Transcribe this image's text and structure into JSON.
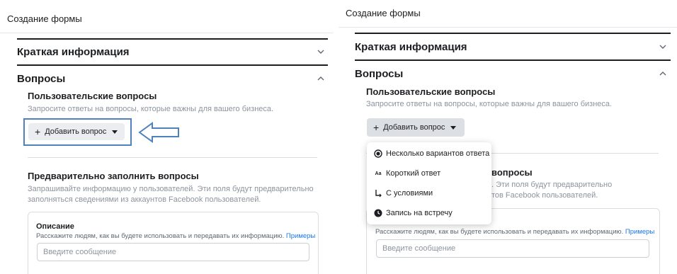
{
  "form_title": "Создание формы",
  "sections": {
    "summary_title": "Краткая информация",
    "questions_title": "Вопросы"
  },
  "custom_questions": {
    "title": "Пользовательские вопросы",
    "description": "Запросите ответы на вопросы, которые важны для вашего бизнеса.",
    "add_button_label": "Добавить вопрос"
  },
  "prefill_questions": {
    "title": "Предварительно заполнить вопросы",
    "description_line1": "Запрашивайте информацию у пользователей. Эти поля будут предварительно",
    "description_line2": "заполняться сведениями из аккаунтов Facebook пользователей.",
    "right_partial_title": "вопросы",
    "right_partial_line1": ". Эти поля будут предварительно",
    "right_partial_line2": "тов Facebook пользователей."
  },
  "description_card": {
    "label": "Описание",
    "hint": "Расскажите людям, как вы будете использовать и передавать их информацию.",
    "hint_link": "Примеры",
    "input_placeholder": "Введите сообщение"
  },
  "dropdown": {
    "items": [
      {
        "label": "Несколько вариантов ответа",
        "icon": "radio-icon"
      },
      {
        "label": "Короткий ответ",
        "icon": "text-aa-icon"
      },
      {
        "label": "С условиями",
        "icon": "conditional-branch-icon"
      },
      {
        "label": "Запись на встречу",
        "icon": "clock-icon"
      }
    ]
  },
  "icons": {
    "chevron_collapsed": "chevron-down-icon",
    "chevron_expanded": "chevron-up-icon",
    "annotation_arrow": "left-arrow-icon"
  },
  "colors": {
    "link": "#1877f2",
    "button_bg": "#ebedf0",
    "highlight": "#4f81bd"
  }
}
